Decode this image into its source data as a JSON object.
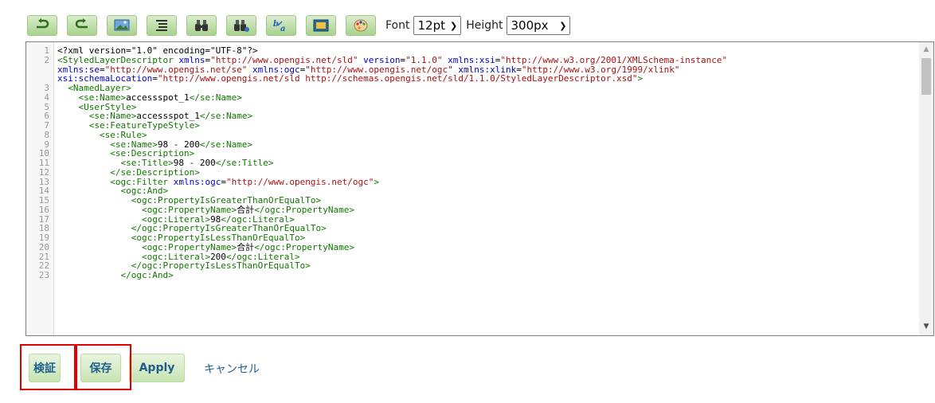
{
  "toolbar": {
    "icons": [
      "undo-icon",
      "redo-icon",
      "picture-icon",
      "indent-icon",
      "binoculars-icon",
      "binoculars-gear-icon",
      "font-replace-icon",
      "image-frame-icon",
      "palette-icon"
    ],
    "font_label": "Font",
    "font_value": "12pt",
    "height_label": "Height",
    "height_value": "300px"
  },
  "editor": {
    "lines": [
      {
        "n": "1",
        "html": "&lt;?xml version=\"1.0\" encoding=\"UTF-8\"?&gt;"
      },
      {
        "n": "2",
        "html": "<span class='tg'>&lt;StyledLayerDescriptor</span> <span class='at'>xmlns</span>=<span class='st'>\"http://www.opengis.net/sld\"</span> <span class='at'>version</span>=<span class='st'>\"1.1.0\"</span> <span class='at'>xmlns:xsi</span>=<span class='st'>\"http://www.w3.org/2001/XMLSchema-instance\"</span>"
      },
      {
        "n": "",
        "html": "<span class='at'>xmlns:se</span>=<span class='st'>\"http://www.opengis.net/se\"</span> <span class='at'>xmlns:ogc</span>=<span class='st'>\"http://www.opengis.net/ogc\"</span> <span class='at'>xmlns:xlink</span>=<span class='st'>\"http://www.w3.org/1999/xlink\"</span>"
      },
      {
        "n": "",
        "html": "<span class='at'>xsi:schemaLocation</span>=<span class='st'>\"http://www.opengis.net/sld http://schemas.opengis.net/sld/1.1.0/StyledLayerDescriptor.xsd\"</span><span class='tg'>&gt;</span>"
      },
      {
        "n": "3",
        "html": "  <span class='tg'>&lt;NamedLayer&gt;</span>"
      },
      {
        "n": "4",
        "html": "    <span class='tg'>&lt;se:Name&gt;</span>accessspot_1<span class='tg'>&lt;/se:Name&gt;</span>"
      },
      {
        "n": "5",
        "html": "    <span class='tg'>&lt;UserStyle&gt;</span>"
      },
      {
        "n": "6",
        "html": "      <span class='tg'>&lt;se:Name&gt;</span>accessspot_1<span class='tg'>&lt;/se:Name&gt;</span>"
      },
      {
        "n": "7",
        "html": "      <span class='tg'>&lt;se:FeatureTypeStyle&gt;</span>"
      },
      {
        "n": "8",
        "html": "        <span class='tg'>&lt;se:Rule&gt;</span>"
      },
      {
        "n": "9",
        "html": "          <span class='tg'>&lt;se:Name&gt;</span>98 - 200<span class='tg'>&lt;/se:Name&gt;</span>"
      },
      {
        "n": "10",
        "html": "          <span class='tg'>&lt;se:Description&gt;</span>"
      },
      {
        "n": "11",
        "html": "            <span class='tg'>&lt;se:Title&gt;</span>98 - 200<span class='tg'>&lt;/se:Title&gt;</span>"
      },
      {
        "n": "12",
        "html": "          <span class='tg'>&lt;/se:Description&gt;</span>"
      },
      {
        "n": "13",
        "html": "          <span class='tg'>&lt;ogc:Filter</span> <span class='at'>xmlns:ogc</span>=<span class='st'>\"http://www.opengis.net/ogc\"</span><span class='tg'>&gt;</span>"
      },
      {
        "n": "14",
        "html": "            <span class='tg'>&lt;ogc:And&gt;</span>"
      },
      {
        "n": "15",
        "html": "              <span class='tg'>&lt;ogc:PropertyIsGreaterThanOrEqualTo&gt;</span>"
      },
      {
        "n": "16",
        "html": "                <span class='tg'>&lt;ogc:PropertyName&gt;</span>合計<span class='tg'>&lt;/ogc:PropertyName&gt;</span>"
      },
      {
        "n": "17",
        "html": "                <span class='tg'>&lt;ogc:Literal&gt;</span>98<span class='tg'>&lt;/ogc:Literal&gt;</span>"
      },
      {
        "n": "18",
        "html": "              <span class='tg'>&lt;/ogc:PropertyIsGreaterThanOrEqualTo&gt;</span>"
      },
      {
        "n": "19",
        "html": "              <span class='tg'>&lt;ogc:PropertyIsLessThanOrEqualTo&gt;</span>"
      },
      {
        "n": "20",
        "html": "                <span class='tg'>&lt;ogc:PropertyName&gt;</span>合計<span class='tg'>&lt;/ogc:PropertyName&gt;</span>"
      },
      {
        "n": "21",
        "html": "                <span class='tg'>&lt;ogc:Literal&gt;</span>200<span class='tg'>&lt;/ogc:Literal&gt;</span>"
      },
      {
        "n": "22",
        "html": "              <span class='tg'>&lt;/ogc:PropertyIsLessThanOrEqualTo&gt;</span>"
      },
      {
        "n": "23",
        "html": "            <span class='tg'>&lt;/ogc:And&gt;</span>"
      }
    ]
  },
  "actions": {
    "validate_label": "検証",
    "save_label": "保存",
    "apply_label": "Apply",
    "cancel_label": "キャンセル"
  },
  "colors": {
    "button_green": "#b9dca0",
    "link_blue": "#1f5e8c",
    "highlight_red": "#e00000",
    "xml_tag": "#117700",
    "xml_attr": "#0000cc",
    "xml_string": "#aa1111"
  }
}
